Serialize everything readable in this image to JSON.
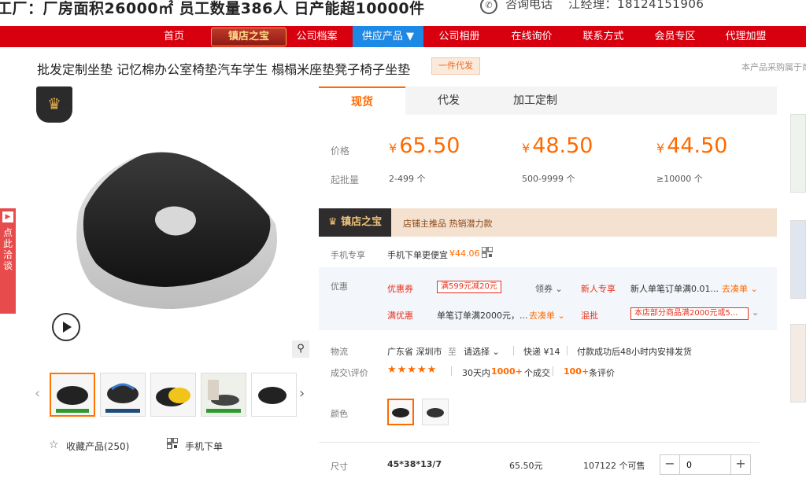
{
  "header": {
    "factory_info": "工厂：厂房面积26000㎡  员工数量386人  日产能超10000件",
    "hotline_label": "咨询电话",
    "hotline_number": "江经理：18124151906"
  },
  "nav": {
    "items": [
      "首页",
      "公司档案",
      "供应产品 ▼",
      "公司相册",
      "在线询价",
      "联系方式",
      "会员专区",
      "代理加盟"
    ],
    "badge": "镇店之宝"
  },
  "product": {
    "title": "批发定制坐垫 记忆棉办公室椅垫汽车学生 榻榻米座垫凳子椅子坐垫",
    "dropship_tag": "一件代发",
    "purchase_note": "本产品采购属于商"
  },
  "gallery": {
    "side_float": "点此洽谈",
    "fav_label": "收藏产品(250)",
    "mobile_label": "手机下单",
    "thumb_count": 5
  },
  "tabs": [
    "现货",
    "代发",
    "加工定制"
  ],
  "pricing": {
    "price_label": "价格",
    "moq_label": "起批量",
    "currency": "¥",
    "tiers": [
      {
        "price": "65.50",
        "range": "2-499 个"
      },
      {
        "price": "48.50",
        "range": "500-9999 个"
      },
      {
        "price": "44.50",
        "range": "≥10000 个"
      }
    ]
  },
  "treasure": {
    "badge": "镇店之宝",
    "text": "店铺主推品  热销潜力款"
  },
  "mobile_exclusive": {
    "label": "手机专享",
    "text": "手机下单更便宜",
    "price": "¥44.06"
  },
  "promotions": {
    "label": "优惠",
    "coupon_label": "优惠券",
    "coupon_tag": "满599元减20元",
    "claim": "领券 ⌄",
    "new_user_label": "新人专享",
    "new_user_text": "新人单笔订单满0.01...",
    "go_order": "去凑单 ⌄",
    "discount_label": "满优惠",
    "discount_text": "单笔订单满2000元，...",
    "mixed_label": "混批",
    "mixed_tag": "本店部分商品满2000元或5..."
  },
  "logistics": {
    "label": "物流",
    "from": "广东省 深圳市",
    "to_label": "至",
    "to": "请选择 ⌄",
    "express": "快递 ¥14",
    "dispatch": "付款成功后48小时内安排发货"
  },
  "reviews": {
    "label": "成交\\评价",
    "stars": "★★★★★",
    "sales_prefix": "30天内",
    "sales_count": "1000+",
    "sales_suffix": "个成交",
    "review_count": "100+",
    "review_suffix": "条评价"
  },
  "color": {
    "label": "颜色"
  },
  "size": {
    "label": "尺寸",
    "value": "45*38*13/7",
    "price": "65.50元",
    "stock": "107122 个可售",
    "quantity": "0"
  },
  "colors": {
    "accent": "#ff6a00",
    "nav_red": "#d8000f",
    "nav_active": "#1e88e5"
  }
}
